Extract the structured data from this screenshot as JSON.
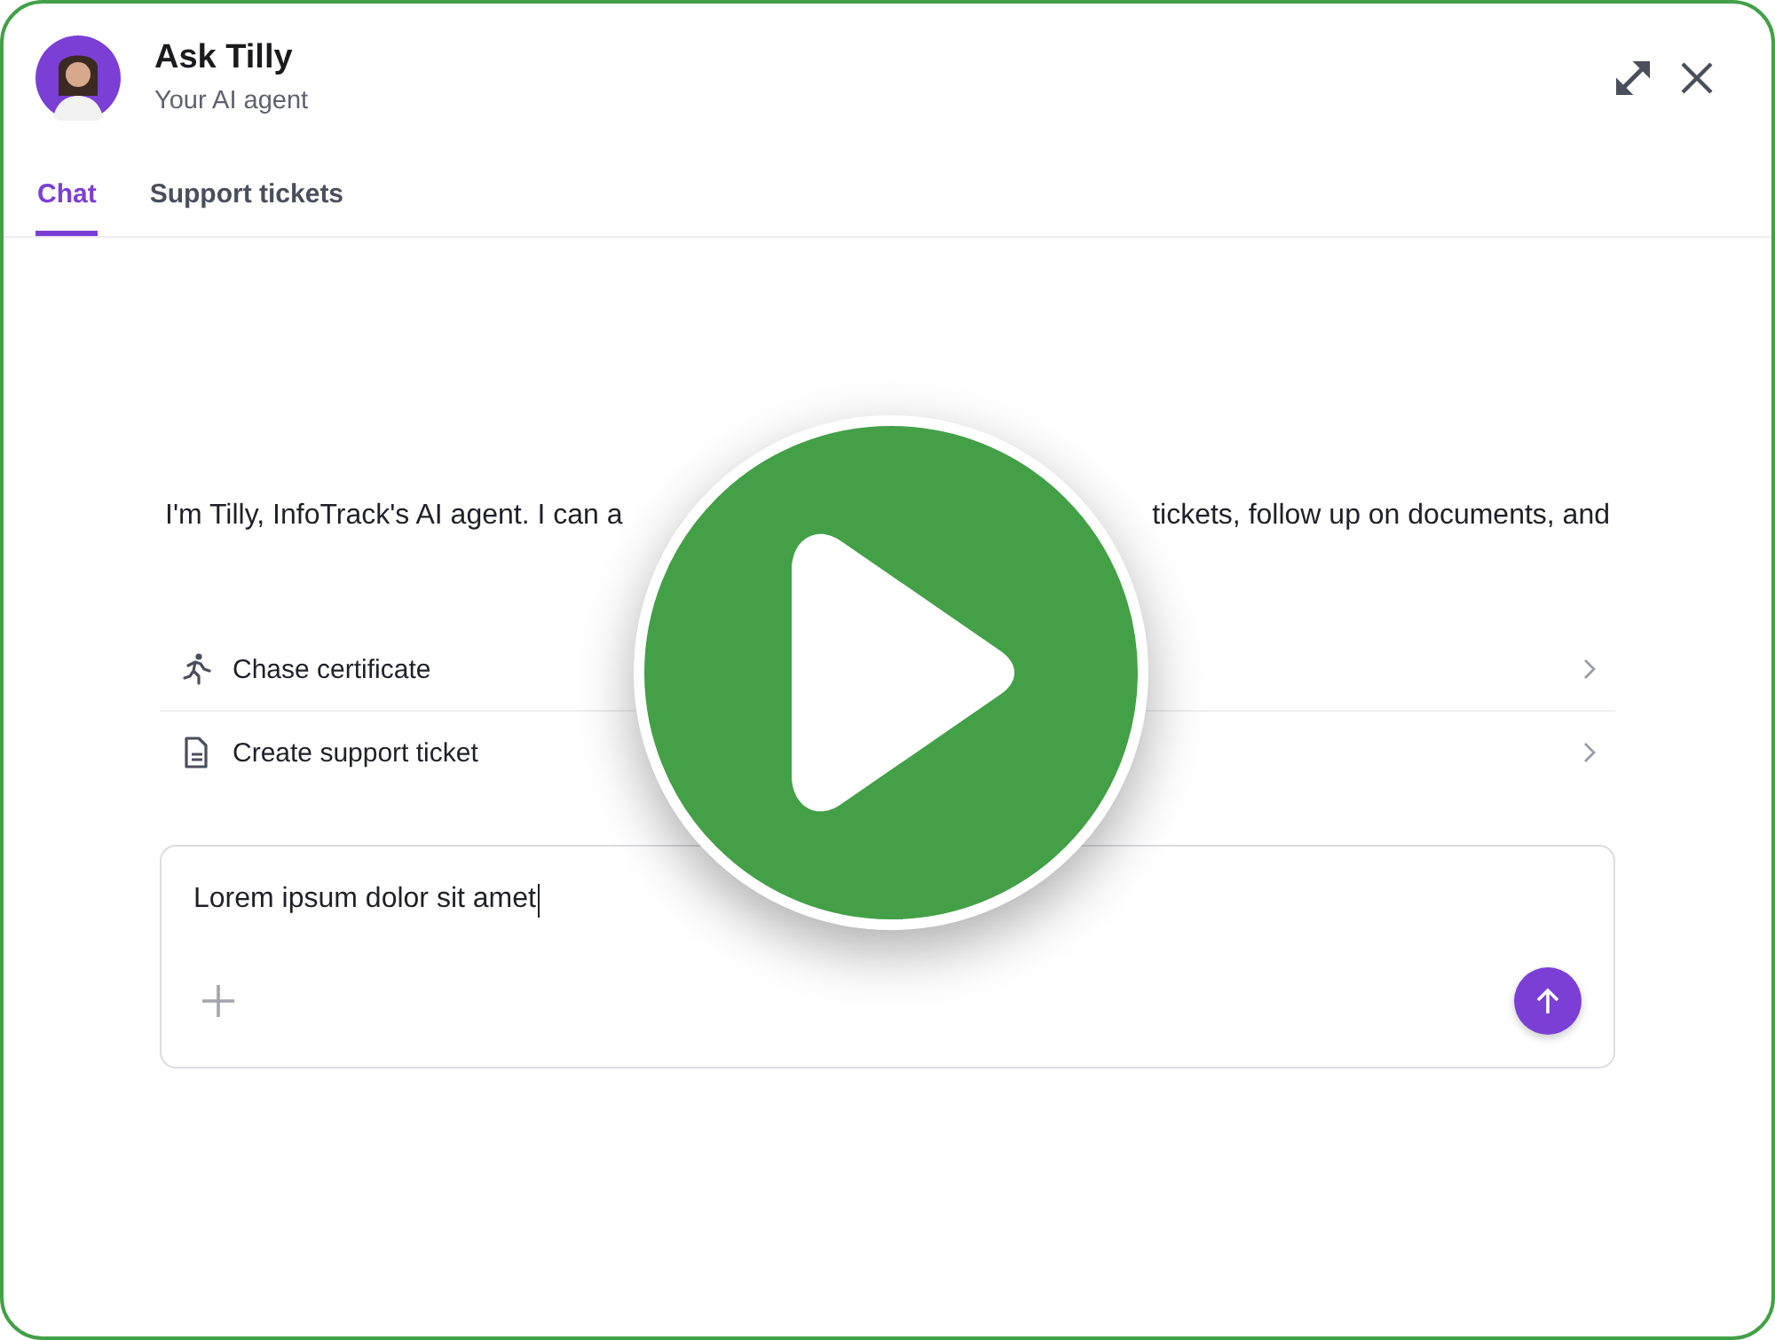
{
  "header": {
    "title": "Ask Tilly",
    "subtitle": "Your AI agent"
  },
  "tabs": [
    {
      "label": "Chat",
      "selected": true
    },
    {
      "label": "Support tickets",
      "selected": false
    }
  ],
  "intro": {
    "visible_start": "I'm Tilly, InfoTrack's AI agent. I can a",
    "visible_end": "tickets, follow up on documents, and"
  },
  "actions": [
    {
      "kind": "chase",
      "label": "Chase certificate"
    },
    {
      "kind": "ticket",
      "label": "Create support ticket"
    }
  ],
  "composer": {
    "value": "Lorem ipsum dolor sit amet"
  }
}
